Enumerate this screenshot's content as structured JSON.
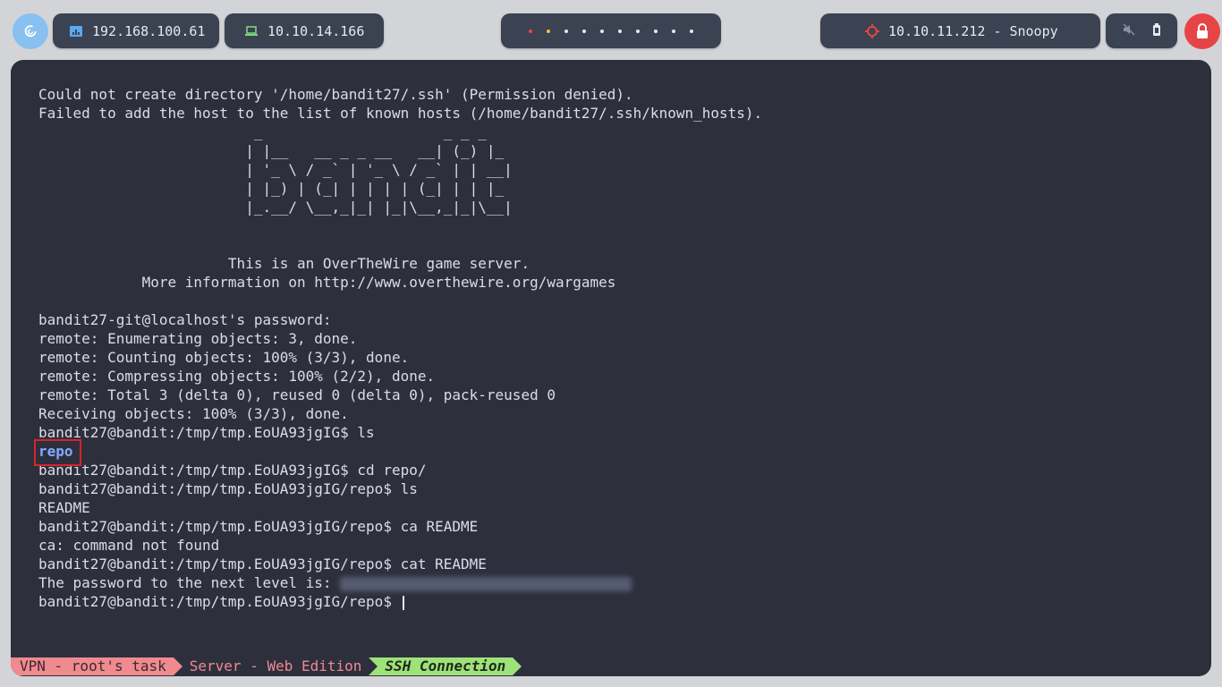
{
  "topbar": {
    "hosts": [
      {
        "label": "192.168.100.61",
        "icon": "network-icon"
      },
      {
        "label": "10.10.14.166",
        "icon": "laptop-icon"
      }
    ],
    "target": {
      "label": "10.10.11.212 - Snoopy",
      "icon": "crosshair-icon"
    },
    "workspaces": [
      {
        "color": "#e64545"
      },
      {
        "color": "#f0c040"
      },
      {
        "color": "#e5e9f0"
      },
      {
        "color": "#e5e9f0"
      },
      {
        "color": "#e5e9f0"
      },
      {
        "color": "#e5e9f0"
      },
      {
        "color": "#e5e9f0"
      },
      {
        "color": "#e5e9f0"
      },
      {
        "color": "#e5e9f0"
      },
      {
        "color": "#e5e9f0"
      }
    ],
    "system_icons": [
      "volume-muted-icon",
      "battery-icon"
    ],
    "power_icon": "lock-icon"
  },
  "terminal": {
    "lines": [
      "Could not create directory '/home/bandit27/.ssh' (Permission denied).",
      "Failed to add the host to the list of known hosts (/home/bandit27/.ssh/known_hosts).",
      "                         _                     _ _ _",
      "                        | |__   __ _ _ __   __| (_) |_",
      "                        | '_ \\ / _` | '_ \\ / _` | | __|",
      "                        | |_) | (_| | | | | (_| | | |_",
      "                        |_.__/ \\__,_|_| |_|\\__,_|_|\\__|",
      "",
      "",
      "                      This is an OverTheWire game server.",
      "            More information on http://www.overthewire.org/wargames",
      "",
      "bandit27-git@localhost's password:",
      "remote: Enumerating objects: 3, done.",
      "remote: Counting objects: 100% (3/3), done.",
      "remote: Compressing objects: 100% (2/2), done.",
      "remote: Total 3 (delta 0), reused 0 (delta 0), pack-reused 0",
      "Receiving objects: 100% (3/3), done.",
      "bandit27@bandit:/tmp/tmp.EoUA93jgIG$ ls",
      "repo",
      "bandit27@bandit:/tmp/tmp.EoUA93jgIG$ cd repo/",
      "bandit27@bandit:/tmp/tmp.EoUA93jgIG/repo$ ls",
      "README",
      "bandit27@bandit:/tmp/tmp.EoUA93jgIG/repo$ ca README",
      "ca: command not found",
      "bandit27@bandit:/tmp/tmp.EoUA93jgIG/repo$ cat README",
      "The password to the next level is: ",
      "bandit27@bandit:/tmp/tmp.EoUA93jgIG/repo$ "
    ],
    "highlight_line": 19,
    "redacted_line": 26,
    "cursor_line": 27
  },
  "statusbar": {
    "seg1": "VPN - root's task",
    "seg2": "Server - Web Edition",
    "seg3": "SSH Connection"
  }
}
